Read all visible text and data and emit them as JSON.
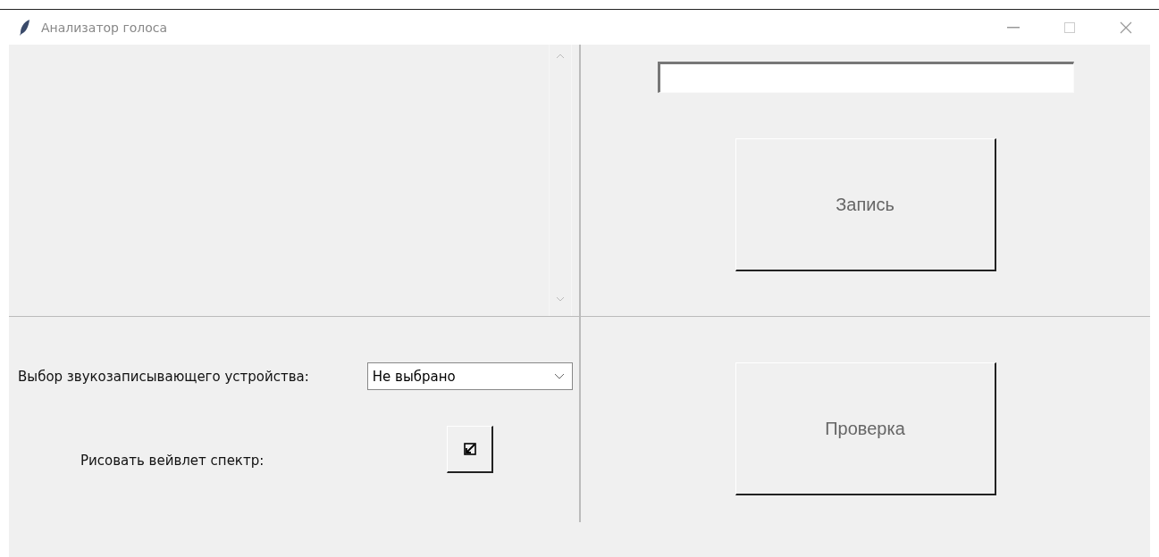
{
  "window": {
    "title": "Анализатор голоса"
  },
  "record_button": {
    "label": "Запись"
  },
  "device": {
    "label": "Выбор звукозаписывающего устройства:",
    "value": "Не выбрано"
  },
  "wavelet": {
    "label": "Рисовать вейвлет спектр:",
    "checked": false
  },
  "check_button": {
    "label": "Проверка"
  }
}
